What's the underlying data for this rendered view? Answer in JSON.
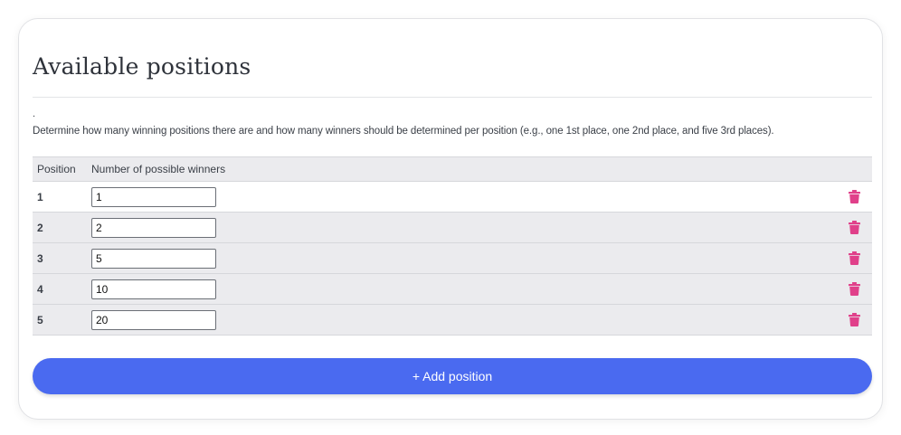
{
  "card": {
    "title": "Available positions",
    "note": ".",
    "description": "Determine how many winning positions there are and how many winners should be determined per position (e.g., one 1st place, one 2nd place, and five 3rd places)."
  },
  "table": {
    "headers": {
      "position": "Position",
      "winners": "Number of possible winners"
    },
    "rows": [
      {
        "position": "1",
        "winners": "1"
      },
      {
        "position": "2",
        "winners": "2"
      },
      {
        "position": "3",
        "winners": "5"
      },
      {
        "position": "4",
        "winners": "10"
      },
      {
        "position": "5",
        "winners": "20"
      }
    ],
    "delete_icon": "trash-icon"
  },
  "add_button": {
    "label": "+ Add position"
  },
  "colors": {
    "accent": "#4a6af0",
    "delete": "#e0408a",
    "row_alt": "#ebebee"
  }
}
